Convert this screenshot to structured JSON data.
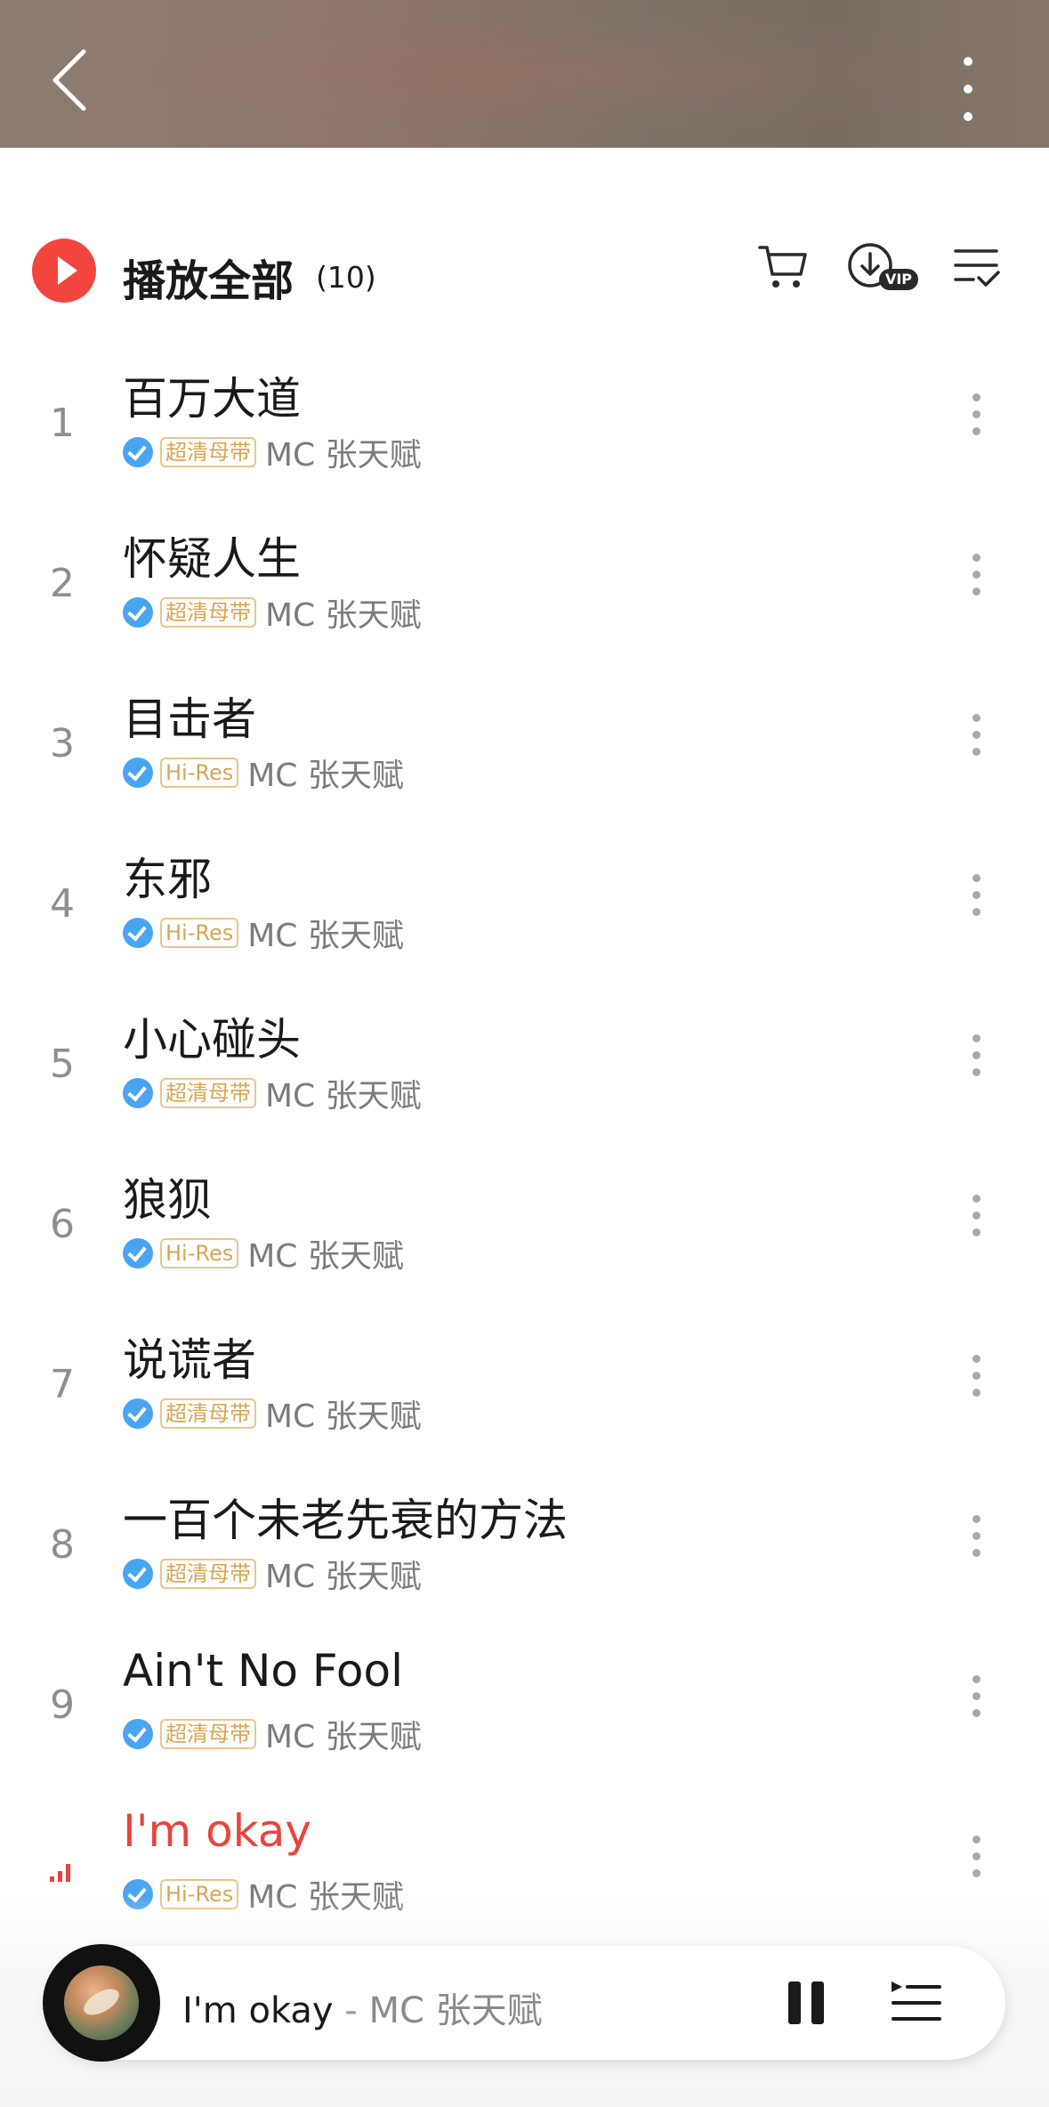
{
  "header": {
    "back_icon": "chevron-left-icon",
    "more_icon": "vertical-ellipsis-icon"
  },
  "play_all": {
    "label": "播放全部",
    "count": "(10)",
    "accent_color": "#f2453d",
    "tools": [
      "cart-icon",
      "download-vip-icon",
      "multi-select-icon"
    ],
    "vip_badge": "VIP"
  },
  "songs": [
    {
      "index": "1",
      "title": "百万大道",
      "quality": "超清母带",
      "artist": "MC 张天赋",
      "active": false
    },
    {
      "index": "2",
      "title": "怀疑人生",
      "quality": "超清母带",
      "artist": "MC 张天赋",
      "active": false
    },
    {
      "index": "3",
      "title": "目击者",
      "quality": "Hi-Res",
      "artist": "MC 张天赋",
      "active": false
    },
    {
      "index": "4",
      "title": "东邪",
      "quality": "Hi-Res",
      "artist": "MC 张天赋",
      "active": false
    },
    {
      "index": "5",
      "title": "小心碰头",
      "quality": "超清母带",
      "artist": "MC 张天赋",
      "active": false
    },
    {
      "index": "6",
      "title": "狼狈",
      "quality": "Hi-Res",
      "artist": "MC 张天赋",
      "active": false
    },
    {
      "index": "7",
      "title": "说谎者",
      "quality": "超清母带",
      "artist": "MC 张天赋",
      "active": false
    },
    {
      "index": "8",
      "title": "一百个未老先衰的方法",
      "quality": "超清母带",
      "artist": "MC 张天赋",
      "active": false
    },
    {
      "index": "9",
      "title": "Ain't No Fool",
      "quality": "超清母带",
      "artist": "MC 张天赋",
      "active": false
    },
    {
      "index": "",
      "title": "I'm okay",
      "quality": "Hi-Res",
      "artist": "MC 张天赋",
      "active": true
    }
  ],
  "player": {
    "title": "I'm okay",
    "separator": " - ",
    "artist": "MC 张天赋",
    "pause_icon": "pause-icon",
    "queue_icon": "playlist-queue-icon"
  },
  "colors": {
    "active_title": "#e8443c",
    "verified": "#4aa5f0",
    "quality_badge": "#d9a552"
  }
}
